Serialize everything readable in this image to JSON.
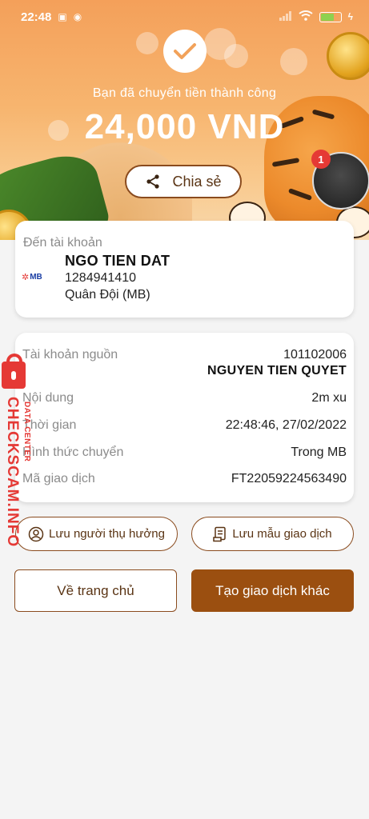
{
  "status_bar": {
    "time": "22:48",
    "left_icons": [
      "zalo-icon",
      "messenger-icon"
    ],
    "right_icons": [
      "signal-icon",
      "wifi-icon",
      "battery-icon",
      "charging-icon"
    ]
  },
  "header": {
    "success_text": "Bạn đã chuyển tiền thành công",
    "amount": "24,000 VND",
    "share_label": "Chia sẻ",
    "chat_head_badge": "1"
  },
  "recipient": {
    "label": "Đến tài khoản",
    "bank_logo_text": "MB",
    "name": "NGO TIEN DAT",
    "account_number": "1284941410",
    "bank_name": "Quân Đội (MB)"
  },
  "details": {
    "rows": [
      {
        "label": "Tài khoản nguồn",
        "value": "101102006",
        "value2": "NGUYEN TIEN QUYET"
      },
      {
        "label": "Nội dung",
        "value": "2m xu"
      },
      {
        "label": "Thời gian",
        "value": "22:48:46, 27/02/2022"
      },
      {
        "label": "Hình thức chuyển",
        "value": "Trong MB"
      },
      {
        "label": "Mã giao dịch",
        "value": "FT22059224563490"
      }
    ]
  },
  "actions": {
    "save_beneficiary": "Lưu người thụ hưởng",
    "save_template": "Lưu mẫu giao dịch",
    "home": "Về trang chủ",
    "new_transaction": "Tạo giao dịch khác"
  },
  "watermark": {
    "main": "CHECKSCAM.INFO",
    "sub": "DATA CENTER"
  },
  "colors": {
    "brand_brown": "#9b4f10",
    "header_orange": "#f4a05a",
    "watermark_red": "#e53935"
  }
}
